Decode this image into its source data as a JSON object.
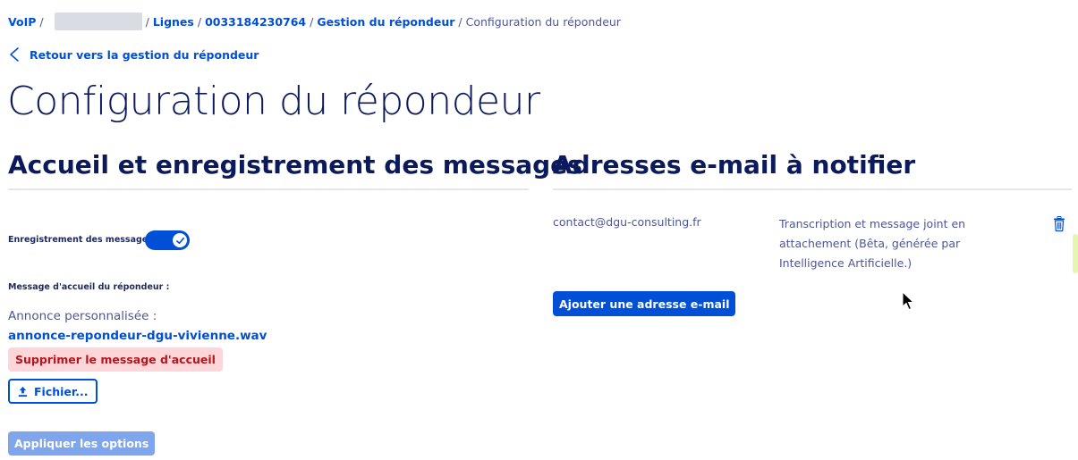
{
  "breadcrumb": {
    "voip": "VoIP",
    "lines": "Lignes",
    "number": "0033184230764",
    "responder_mgmt": "Gestion du répondeur",
    "current": "Configuration du répondeur"
  },
  "back_link": "Retour vers la gestion du répondeur",
  "page_title": "Configuration du répondeur",
  "left": {
    "title": "Accueil et enregistrement des messages",
    "record_label": "Enregistrement des messages :",
    "record_enabled": true,
    "welcome_label": "Message d'accueil du répondeur :",
    "announcement_label": "Annonce personnalisée :",
    "announcement_file": "annonce-repondeur-dgu-vivienne.wav",
    "delete_button": "Supprimer le message d'accueil",
    "file_button": "Fichier...",
    "apply_button": "Appliquer les options"
  },
  "right": {
    "title": "Adresses e-mail à notifier",
    "email": "contact@dgu-consulting.fr",
    "description": "Transcription et message joint en attachement (Bêta, générée par Intelligence Artificielle.)",
    "add_button": "Ajouter une adresse e-mail"
  },
  "colors": {
    "primary": "#0050d7",
    "title": "#0a1a5c",
    "text": "#4d5693",
    "danger_bg": "#fcd6d8",
    "danger_text": "#b8141c",
    "disabled_bg": "#7fa6ec"
  },
  "icons": {
    "back": "chevron-left-icon",
    "toggle_check": "check-icon",
    "upload": "upload-icon",
    "delete_email": "trash-icon"
  }
}
